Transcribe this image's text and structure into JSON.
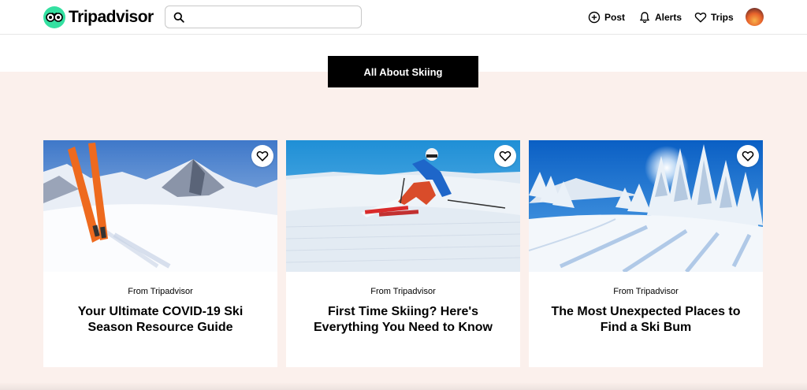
{
  "brand": {
    "name": "Tripadvisor",
    "accent": "#34e0a1"
  },
  "search": {
    "value": "",
    "placeholder": ""
  },
  "nav": {
    "post": "Post",
    "alerts": "Alerts",
    "trips": "Trips"
  },
  "section": {
    "title": "All About Skiing",
    "background": "#fbf0ec"
  },
  "cards": [
    {
      "source": "From Tripadvisor",
      "title": "Your Ultimate COVID-19 Ski Season Resource Guide",
      "image_icon": "skis-in-snow-photo"
    },
    {
      "source": "From Tripadvisor",
      "title": "First Time Skiing? Here's Everything You Need to Know",
      "image_icon": "skier-on-slope-photo"
    },
    {
      "source": "From Tripadvisor",
      "title": "The Most Unexpected Places to Find a Ski Bum",
      "image_icon": "snowy-forest-photo"
    }
  ]
}
